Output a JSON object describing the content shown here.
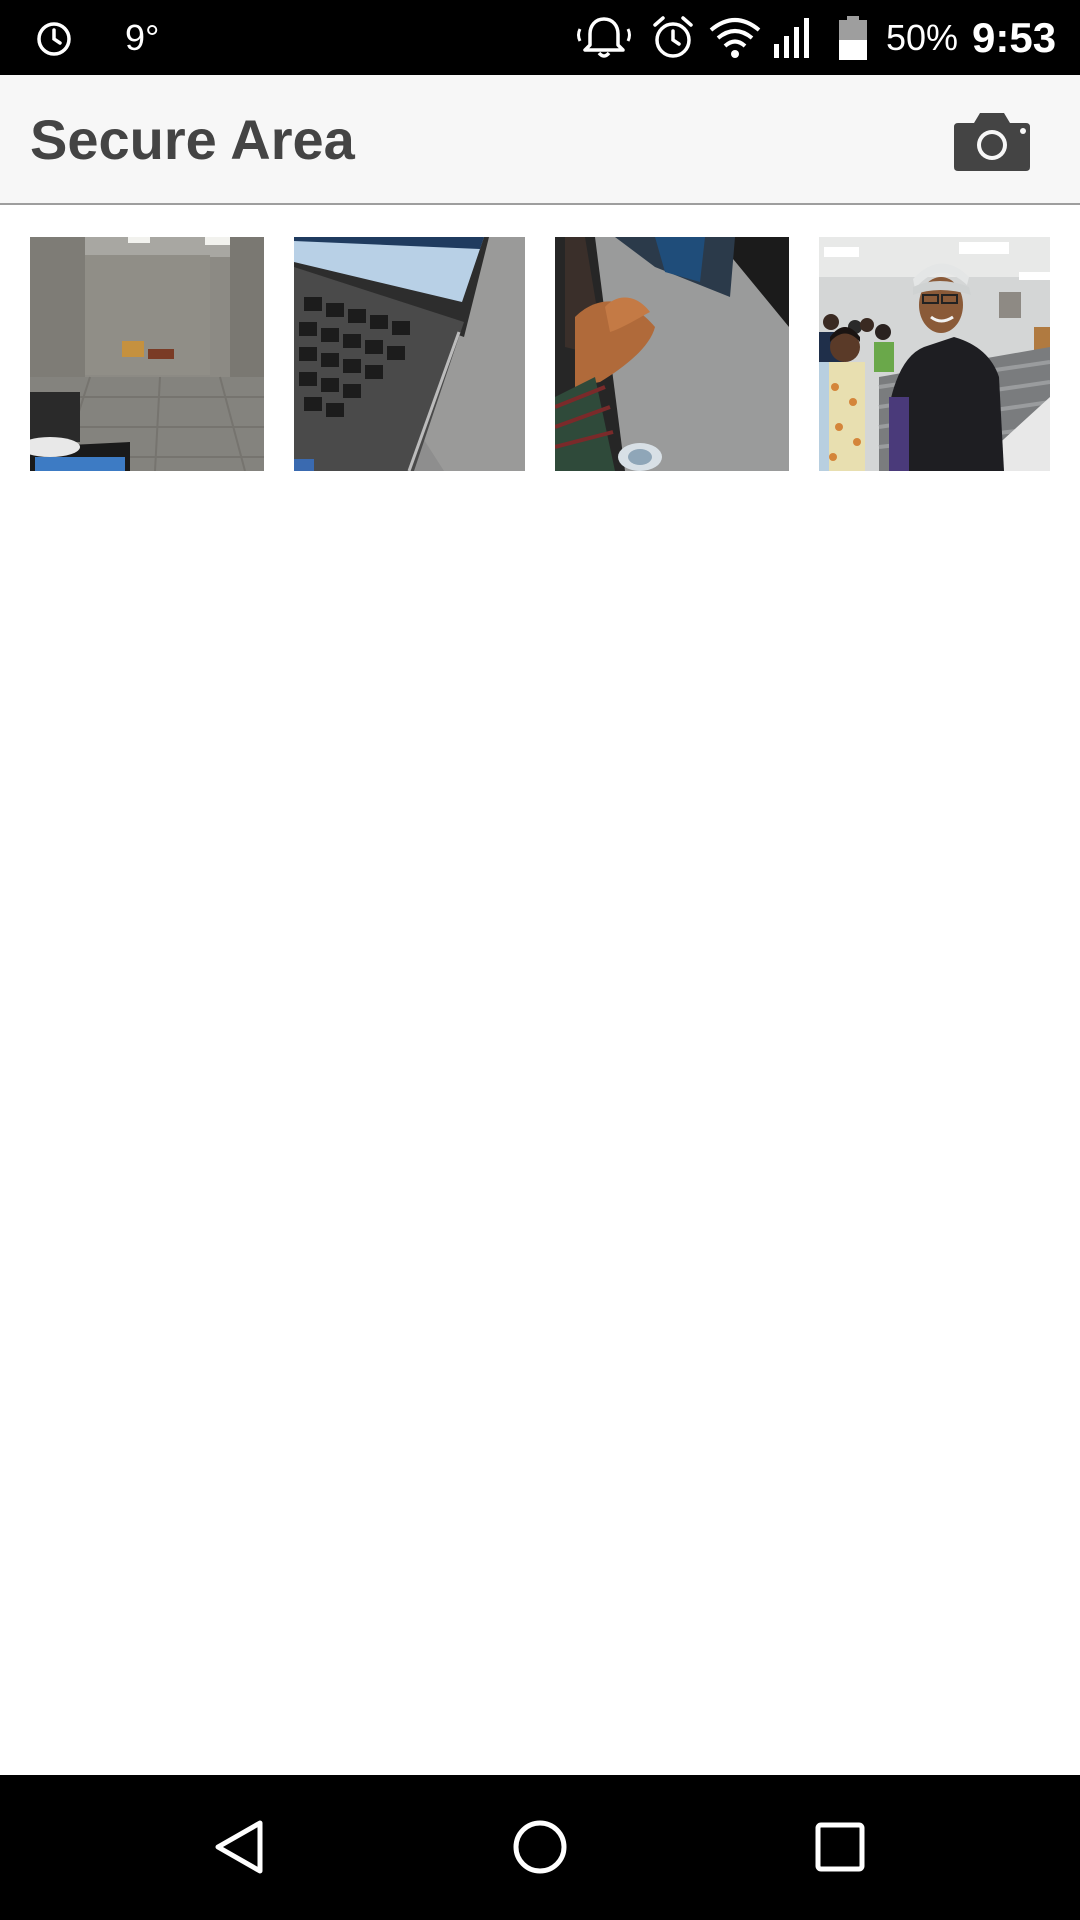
{
  "status_bar": {
    "temperature": "9°",
    "battery_percent": "50%",
    "battery_level": 0.5,
    "time": "9:53",
    "icons": [
      "alarm-icon",
      "bell-icon",
      "alarm-clock-icon",
      "wifi-icon",
      "signal-icon",
      "battery-icon"
    ]
  },
  "app_bar": {
    "title": "Secure Area",
    "action_icon": "camera-icon"
  },
  "photos": [
    {
      "name": "photo-empty-room"
    },
    {
      "name": "photo-laptop-keyboard"
    },
    {
      "name": "photo-hand-on-desk"
    },
    {
      "name": "photo-people-classroom"
    }
  ],
  "nav_bar": {
    "icons": [
      "back-icon",
      "home-icon",
      "recents-icon"
    ]
  },
  "colors": {
    "app_bar_background": "#f7f7f7",
    "title_text": "#444444",
    "system_bars": "#000000"
  }
}
